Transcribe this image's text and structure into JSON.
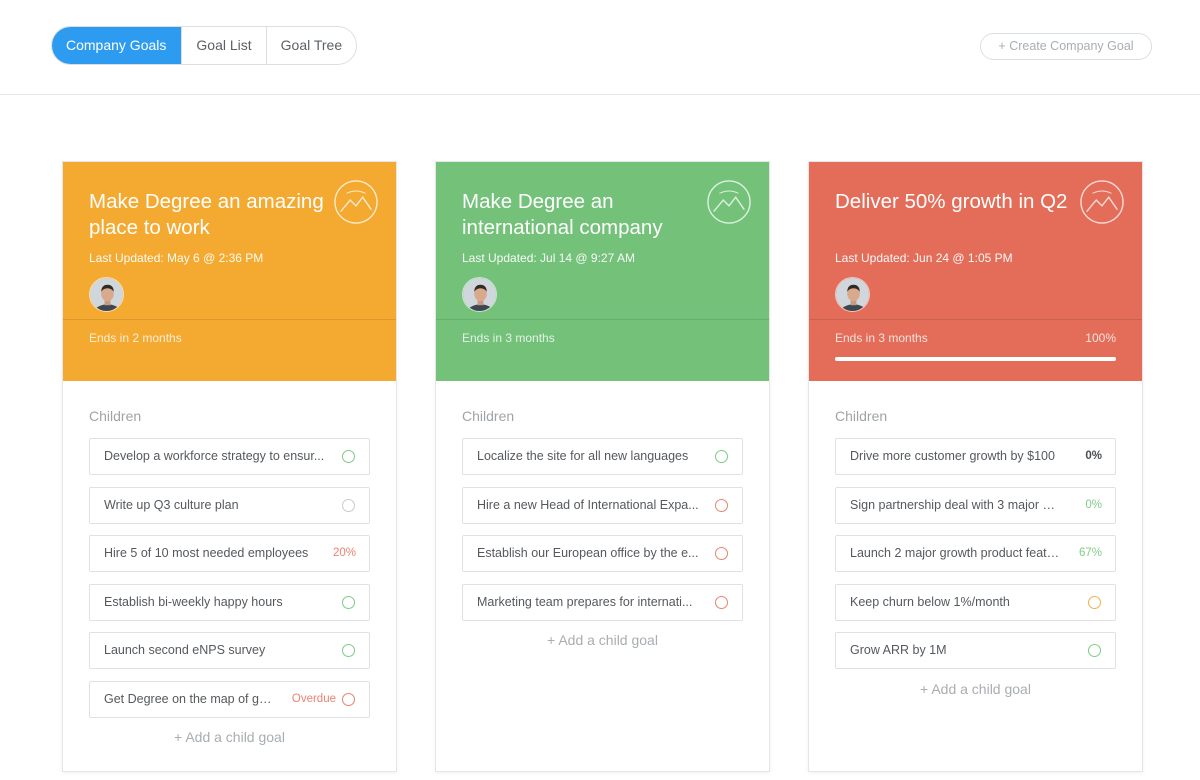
{
  "tabs": [
    {
      "label": "Company Goals",
      "active": true
    },
    {
      "label": "Goal List",
      "active": false
    },
    {
      "label": "Goal Tree",
      "active": false
    }
  ],
  "create_button": "+ Create Company Goal",
  "cards": [
    {
      "color": "#f4a930",
      "title": "Make Degree an amazing place to work",
      "updated": "Last Updated: May 6 @ 2:36 PM",
      "ends": "Ends in 2 months",
      "progress_label": "",
      "progress": null,
      "children_label": "Children",
      "children": [
        {
          "text": "Develop a workforce strategy to ensure we are...",
          "display": "Develop a workforce strategy to ensur...",
          "status": "",
          "circle": "green"
        },
        {
          "text": "Write up Q3 culture plan",
          "display": "Write up Q3 culture plan",
          "status": "",
          "circle": "gray"
        },
        {
          "text": "Hire 5 of 10 most needed employees",
          "display": "Hire 5 of 10 most needed employees",
          "status": "20%",
          "status_color": "red",
          "circle": ""
        },
        {
          "text": "Establish bi-weekly happy hours",
          "display": "Establish bi-weekly happy hours",
          "status": "",
          "circle": "green"
        },
        {
          "text": "Launch second eNPS survey",
          "display": "Launch second eNPS survey",
          "status": "",
          "circle": "green"
        },
        {
          "text": "Get Degree on the map of go...",
          "display": "Get Degree on the map of go...",
          "status": "Overdue",
          "status_color": "red",
          "circle": "red"
        }
      ],
      "add_child": "+ Add a child goal"
    },
    {
      "color": "#74c17a",
      "title": "Make Degree an international company",
      "updated": "Last Updated: Jul 14 @ 9:27 AM",
      "ends": "Ends in 3 months",
      "progress_label": "",
      "progress": null,
      "children_label": "Children",
      "children": [
        {
          "text": "Localize the site for all new languages",
          "display": "Localize the site for all new languages",
          "status": "",
          "circle": "green"
        },
        {
          "text": "Hire a new Head of International Expa...",
          "display": "Hire a new Head of International Expa...",
          "status": "",
          "circle": "red"
        },
        {
          "text": "Establish our European office by the e...",
          "display": "Establish our European office by the e...",
          "status": "",
          "circle": "red"
        },
        {
          "text": "Marketing team prepares for internati...",
          "display": "Marketing team prepares for internati...",
          "status": "",
          "circle": "red"
        }
      ],
      "add_child": "+ Add a child goal"
    },
    {
      "color": "#e36d59",
      "title": "Deliver 50% growth in Q2",
      "updated": "Last Updated: Jun 24 @ 1:05 PM",
      "ends": "Ends in 3 months",
      "progress_label": "100%",
      "progress": 1.0,
      "children_label": "Children",
      "children": [
        {
          "text": "Drive more customer growth by $100",
          "display": "Drive more customer growth by $100",
          "status": "0%",
          "status_color": "dark",
          "circle": ""
        },
        {
          "text": "Sign partnership deal with 3 major me...",
          "display": "Sign partnership deal with 3 major me...",
          "status": "0%",
          "status_color": "green",
          "circle": ""
        },
        {
          "text": "Launch 2 major growth product featu...",
          "display": "Launch 2 major growth product featu...",
          "status": "67%",
          "status_color": "green",
          "circle": ""
        },
        {
          "text": "Keep churn below 1%/month",
          "display": "Keep churn below 1%/month",
          "status": "",
          "circle": "orange"
        },
        {
          "text": "Grow ARR by 1M",
          "display": "Grow ARR by 1M",
          "status": "",
          "circle": "green"
        }
      ],
      "add_child": "+ Add a child goal"
    }
  ]
}
